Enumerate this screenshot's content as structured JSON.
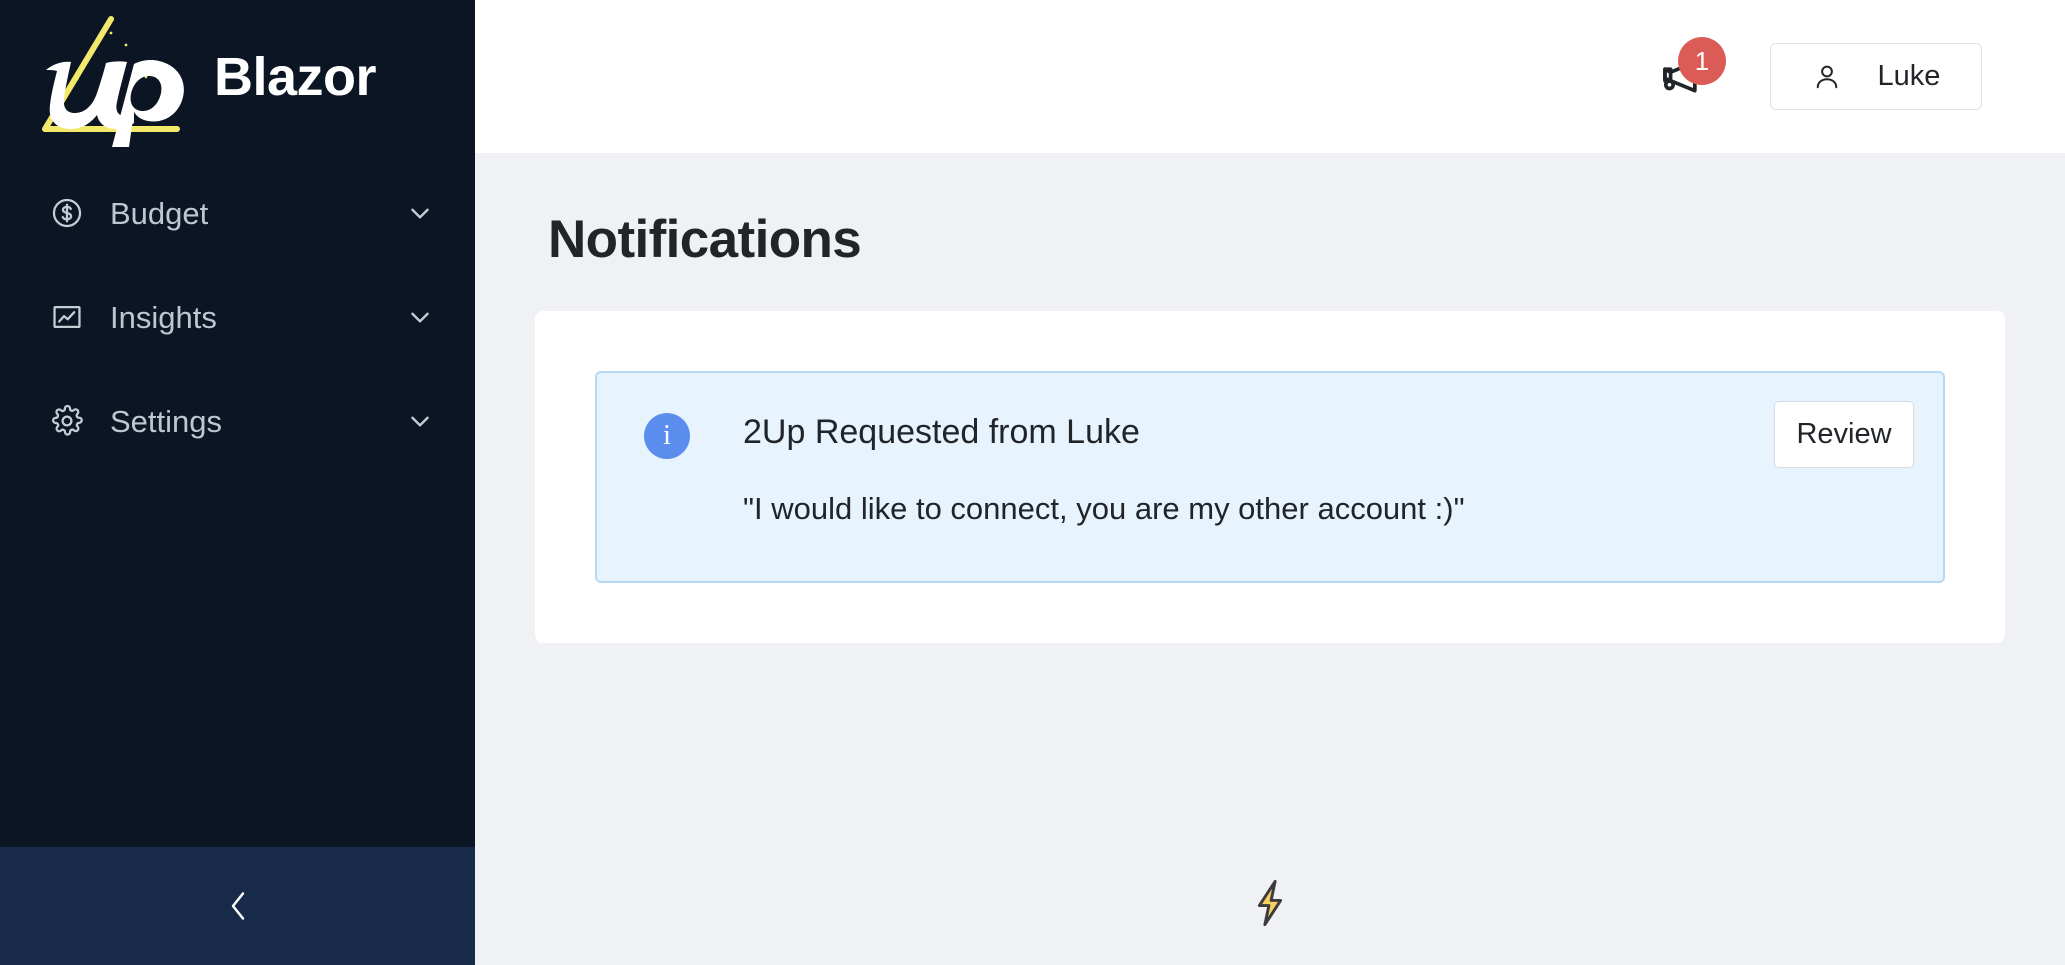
{
  "brand": {
    "name": "Blazor",
    "logo_icon": "up-triangle-logo",
    "logo_colors": {
      "triangle": "#F2E96B",
      "wordmark": "#FFFFFF"
    }
  },
  "sidebar": {
    "background": "#0B1523",
    "footer_background": "#172A4A",
    "items": [
      {
        "label": "Budget",
        "icon": "dollar-circle-icon",
        "chevron": "chevron-down-icon"
      },
      {
        "label": "Insights",
        "icon": "line-chart-icon",
        "chevron": "chevron-down-icon"
      },
      {
        "label": "Settings",
        "icon": "gear-icon",
        "chevron": "chevron-down-icon"
      }
    ],
    "collapse": {
      "icon": "chevron-left-icon"
    }
  },
  "topbar": {
    "announcements": {
      "icon": "megaphone-icon",
      "badge_count": "1",
      "badge_color": "#DB5C57"
    },
    "user": {
      "icon": "person-icon",
      "name": "Luke"
    }
  },
  "page": {
    "title": "Notifications"
  },
  "notifications": [
    {
      "icon": "info-circle-icon",
      "icon_color": "#5B8DEF",
      "title": "2Up Requested from Luke",
      "message": "\"I would like to connect, you are my other account :)\"",
      "action_label": "Review",
      "background": "#E8F4FD",
      "border_color": "#B6DAF5"
    }
  ],
  "footer": {
    "icon": "lightning-bolt-icon",
    "bolt_color": "#F7D060"
  }
}
